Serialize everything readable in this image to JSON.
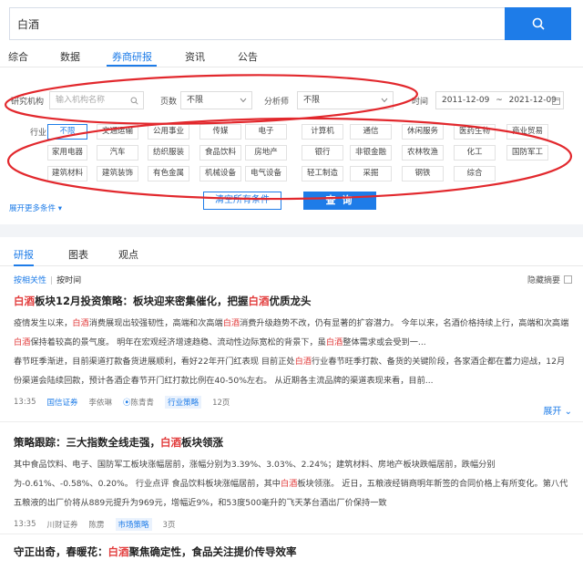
{
  "search": {
    "value": "白酒"
  },
  "top_tabs": [
    "综合",
    "数据",
    "券商研报",
    "资讯",
    "公告"
  ],
  "filters": {
    "org_label": "研究机构",
    "org_placeholder": "输入机构名称",
    "pages_label": "页数",
    "pages_value": "不限",
    "analyst_label": "分析师",
    "analyst_value": "不限",
    "time_label": "时间",
    "date_start": "2011-12-09",
    "date_sep": "~",
    "date_end": "2021-12-09"
  },
  "industry_label": "行业",
  "industries": [
    [
      "不限",
      "交通运输",
      "公用事业",
      "传媒",
      "电子",
      "计算机",
      "通信",
      "休闲服务",
      "医药生物",
      "商业贸易"
    ],
    [
      "家用电器",
      "汽车",
      "纺织服装",
      "食品饮料",
      "房地产",
      "银行",
      "非银金融",
      "农林牧渔",
      "化工",
      "国防军工"
    ],
    [
      "建筑材料",
      "建筑装饰",
      "有色金属",
      "机械设备",
      "电气设备",
      "轻工制造",
      "采掘",
      "钢铁",
      "综合"
    ]
  ],
  "buttons": {
    "clear": "清空所有条件",
    "query": "查 询",
    "expand_more": "展开更多条件"
  },
  "sub_tabs": [
    "研报",
    "图表",
    "观点"
  ],
  "sort": {
    "relevance": "按相关性",
    "time": "按时间",
    "hide_summary": "隐藏摘要"
  },
  "articles": [
    {
      "title_parts": [
        "",
        "白酒",
        "板块12月投资策略：板块迎来密集催化，把握",
        "白酒",
        "优质龙头"
      ],
      "para1_parts": [
        "疫情发生以来，",
        "白酒",
        "消费展现出较强韧性，高端和次高端",
        "白酒",
        "消费升级趋势不改，仍有显著的扩容潜力。 今年以来，名酒价格持续上行，高端和次高端",
        "白酒",
        "保持着较高的景气度。 明年在宏观经济增速趋稳、流动性边际宽松的背景下，虽",
        "白酒",
        "整体需求或会受到一..."
      ],
      "para2_parts": [
        "春节旺季渐进，目前渠道打款备货进展顺利，看好22年开门红表现 目前正处",
        "白酒",
        "行业春节旺季打款、备货的关键阶段，各家酒企都在蓄力迎战，12月份渠道会陆续回款，预计各酒企春节开门红打款比例在40-50%左右。 从近期各主流品牌的渠道表现来看，目前..."
      ],
      "time": "13:35",
      "org": "国信证券",
      "author1": "李依琳",
      "author2": "陈青青",
      "category": "行业策略",
      "pages": "12页",
      "expand": "展开"
    },
    {
      "title_parts": [
        "策略跟踪：三大指数全线走强，",
        "白酒",
        "板块领涨"
      ],
      "para1_parts": [
        "其中食品饮料、电子、国防军工板块涨幅居前，涨幅分别为3.39%、3.03%、2.24%；建筑材料、房地产板块跌幅居前，跌幅分别为-0.61%、-0.58%、0.20%。 行业点评 食品饮料板块涨幅居前，其中",
        "白酒",
        "板块领涨。 近日，五粮液经销商明年新签的合同价格上有所变化。第八代五粮液的出厂价将从889元提升为969元，增幅近9%，和53度500毫升的飞天茅台酒出厂价保持一致"
      ],
      "time": "13:35",
      "org": "川财证券",
      "author1": "陈雳",
      "category": "市场策略",
      "pages": "3页"
    },
    {
      "title_parts": [
        "守正出奇，春暖花：",
        "白酒",
        "聚焦确定性，食品关注提价传导效率"
      ]
    }
  ]
}
